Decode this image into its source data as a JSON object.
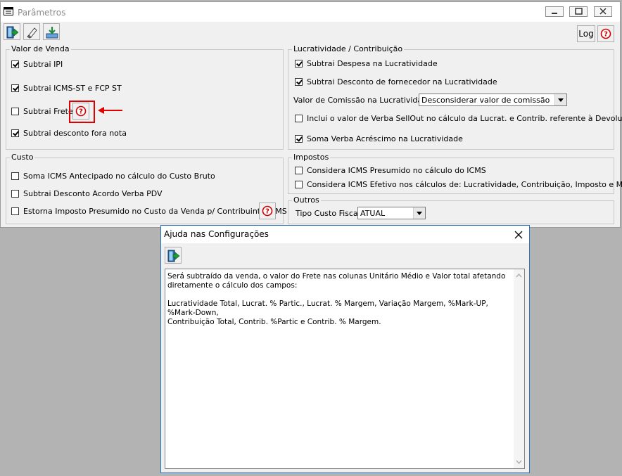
{
  "window": {
    "title": "Parâmetros"
  },
  "toolbar": {
    "log_label": "Log"
  },
  "valor_venda": {
    "legend": "Valor de Venda",
    "items": [
      {
        "label": "Subtrai IPI",
        "checked": true
      },
      {
        "label": "Subtrai ICMS-ST e FCP ST",
        "checked": true
      },
      {
        "label": "Subtrai Frete",
        "checked": false
      },
      {
        "label": "Subtrai desconto fora nota",
        "checked": true
      }
    ]
  },
  "custo": {
    "legend": "Custo",
    "items": [
      {
        "label": "Soma ICMS Antecipado no cálculo do Custo Bruto",
        "checked": false
      },
      {
        "label": "Subtrai Desconto Acordo Verba PDV",
        "checked": false
      },
      {
        "label": "Estorna Imposto Presumido no Custo da Venda p/ Contribuinte ICMS",
        "checked": false
      }
    ]
  },
  "lucratividade": {
    "legend": "Lucratividade / Contribuição",
    "items": [
      {
        "label": "Subtrai Despesa na Lucratividade",
        "checked": true
      },
      {
        "label": "Subtrai Desconto de fornecedor na Lucratividade",
        "checked": true
      },
      {
        "label": "Inclui o valor de Verba SellOut no cálculo da Lucrat. e Contrib. referente à Devoluções",
        "checked": false
      },
      {
        "label": "Soma Verba Acréscimo na Lucratividade",
        "checked": true
      }
    ],
    "comissao_label": "Valor de Comissão na Lucratividade:",
    "comissao_value": "Desconsiderar valor de comissão"
  },
  "impostos": {
    "legend": "Impostos",
    "items": [
      {
        "label": "Considera ICMS Presumido no cálculo do ICMS",
        "checked": false
      },
      {
        "label": "Considera ICMS Efetivo nos cálculos de: Lucratividade, Contribuição, Imposto e Margem",
        "checked": false
      }
    ]
  },
  "outros": {
    "legend": "Outros",
    "tipo_custo_label": "Tipo Custo Fiscal",
    "tipo_custo_value": "ATUAL"
  },
  "help_dialog": {
    "title": "Ajuda nas Configurações",
    "text": "Será subtraído da venda, o valor do Frete nas colunas Unitário Médio e Valor total afetando\ndiretamente o cálculo dos campos:\n\nLucratividade Total, Lucrat. % Partic., Lucrat. % Margem, Variação Margem, %Mark-UP, %Mark-Down,\nContribuição Total, Contrib. %Partic e Contrib. % Margem."
  },
  "colors": {
    "highlight": "#e00000",
    "accent": "#2b71c4"
  }
}
